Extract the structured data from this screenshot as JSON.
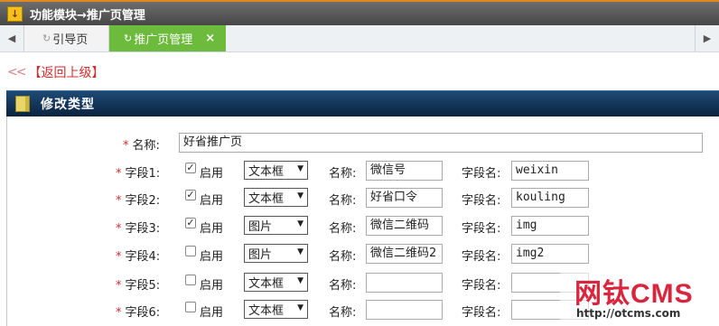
{
  "header": {
    "title": "功能模块→推广页管理"
  },
  "tabs": [
    {
      "label": "引导页",
      "refresh_icon": "refresh-icon"
    },
    {
      "label": "推广页管理",
      "refresh_icon": "refresh-icon",
      "close": "×"
    }
  ],
  "back_link": {
    "chevrons": "<<",
    "label": "【返回上级】"
  },
  "panel": {
    "title": "修改类型"
  },
  "form": {
    "name_label": "名称:",
    "name_value": "好省推广页",
    "enable_label": "启用",
    "field_name_label": "名称:",
    "field_key_label": "字段名:",
    "fields": [
      {
        "label": "字段1:",
        "enabled": true,
        "type": "文本框",
        "name": "微信号",
        "key": "weixin"
      },
      {
        "label": "字段2:",
        "enabled": true,
        "type": "文本框",
        "name": "好省口令",
        "key": "kouling"
      },
      {
        "label": "字段3:",
        "enabled": true,
        "type": "图片",
        "name": "微信二维码",
        "key": "img"
      },
      {
        "label": "字段4:",
        "enabled": false,
        "type": "图片",
        "name": "微信二维码2",
        "key": "img2"
      },
      {
        "label": "字段5:",
        "enabled": false,
        "type": "文本框",
        "name": "",
        "key": ""
      },
      {
        "label": "字段6:",
        "enabled": false,
        "type": "文本框",
        "name": "",
        "key": ""
      }
    ]
  },
  "watermark": {
    "brand": "网钛CMS",
    "url": "http://otcms.com"
  },
  "colors": {
    "tab_active": "#6dbb3d",
    "panel_header": "#0a2340",
    "required": "#d12b2b"
  }
}
